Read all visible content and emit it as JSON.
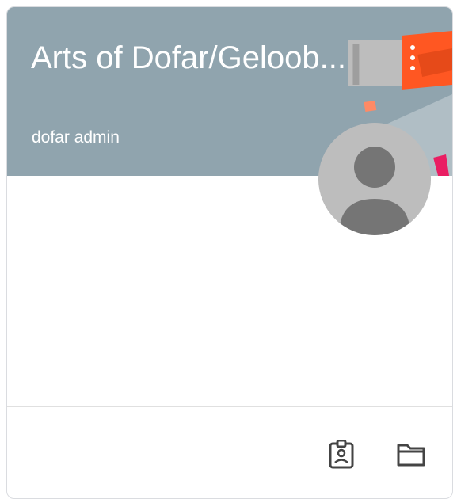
{
  "card": {
    "title": "Arts of Dofar/Geloob...",
    "owner": "dofar admin",
    "header_color": "#90a4ae"
  },
  "icons": {
    "more": "more-vert-icon",
    "avatar": "default-user-avatar",
    "work": "assignment-ind-icon",
    "folder": "folder-icon"
  }
}
